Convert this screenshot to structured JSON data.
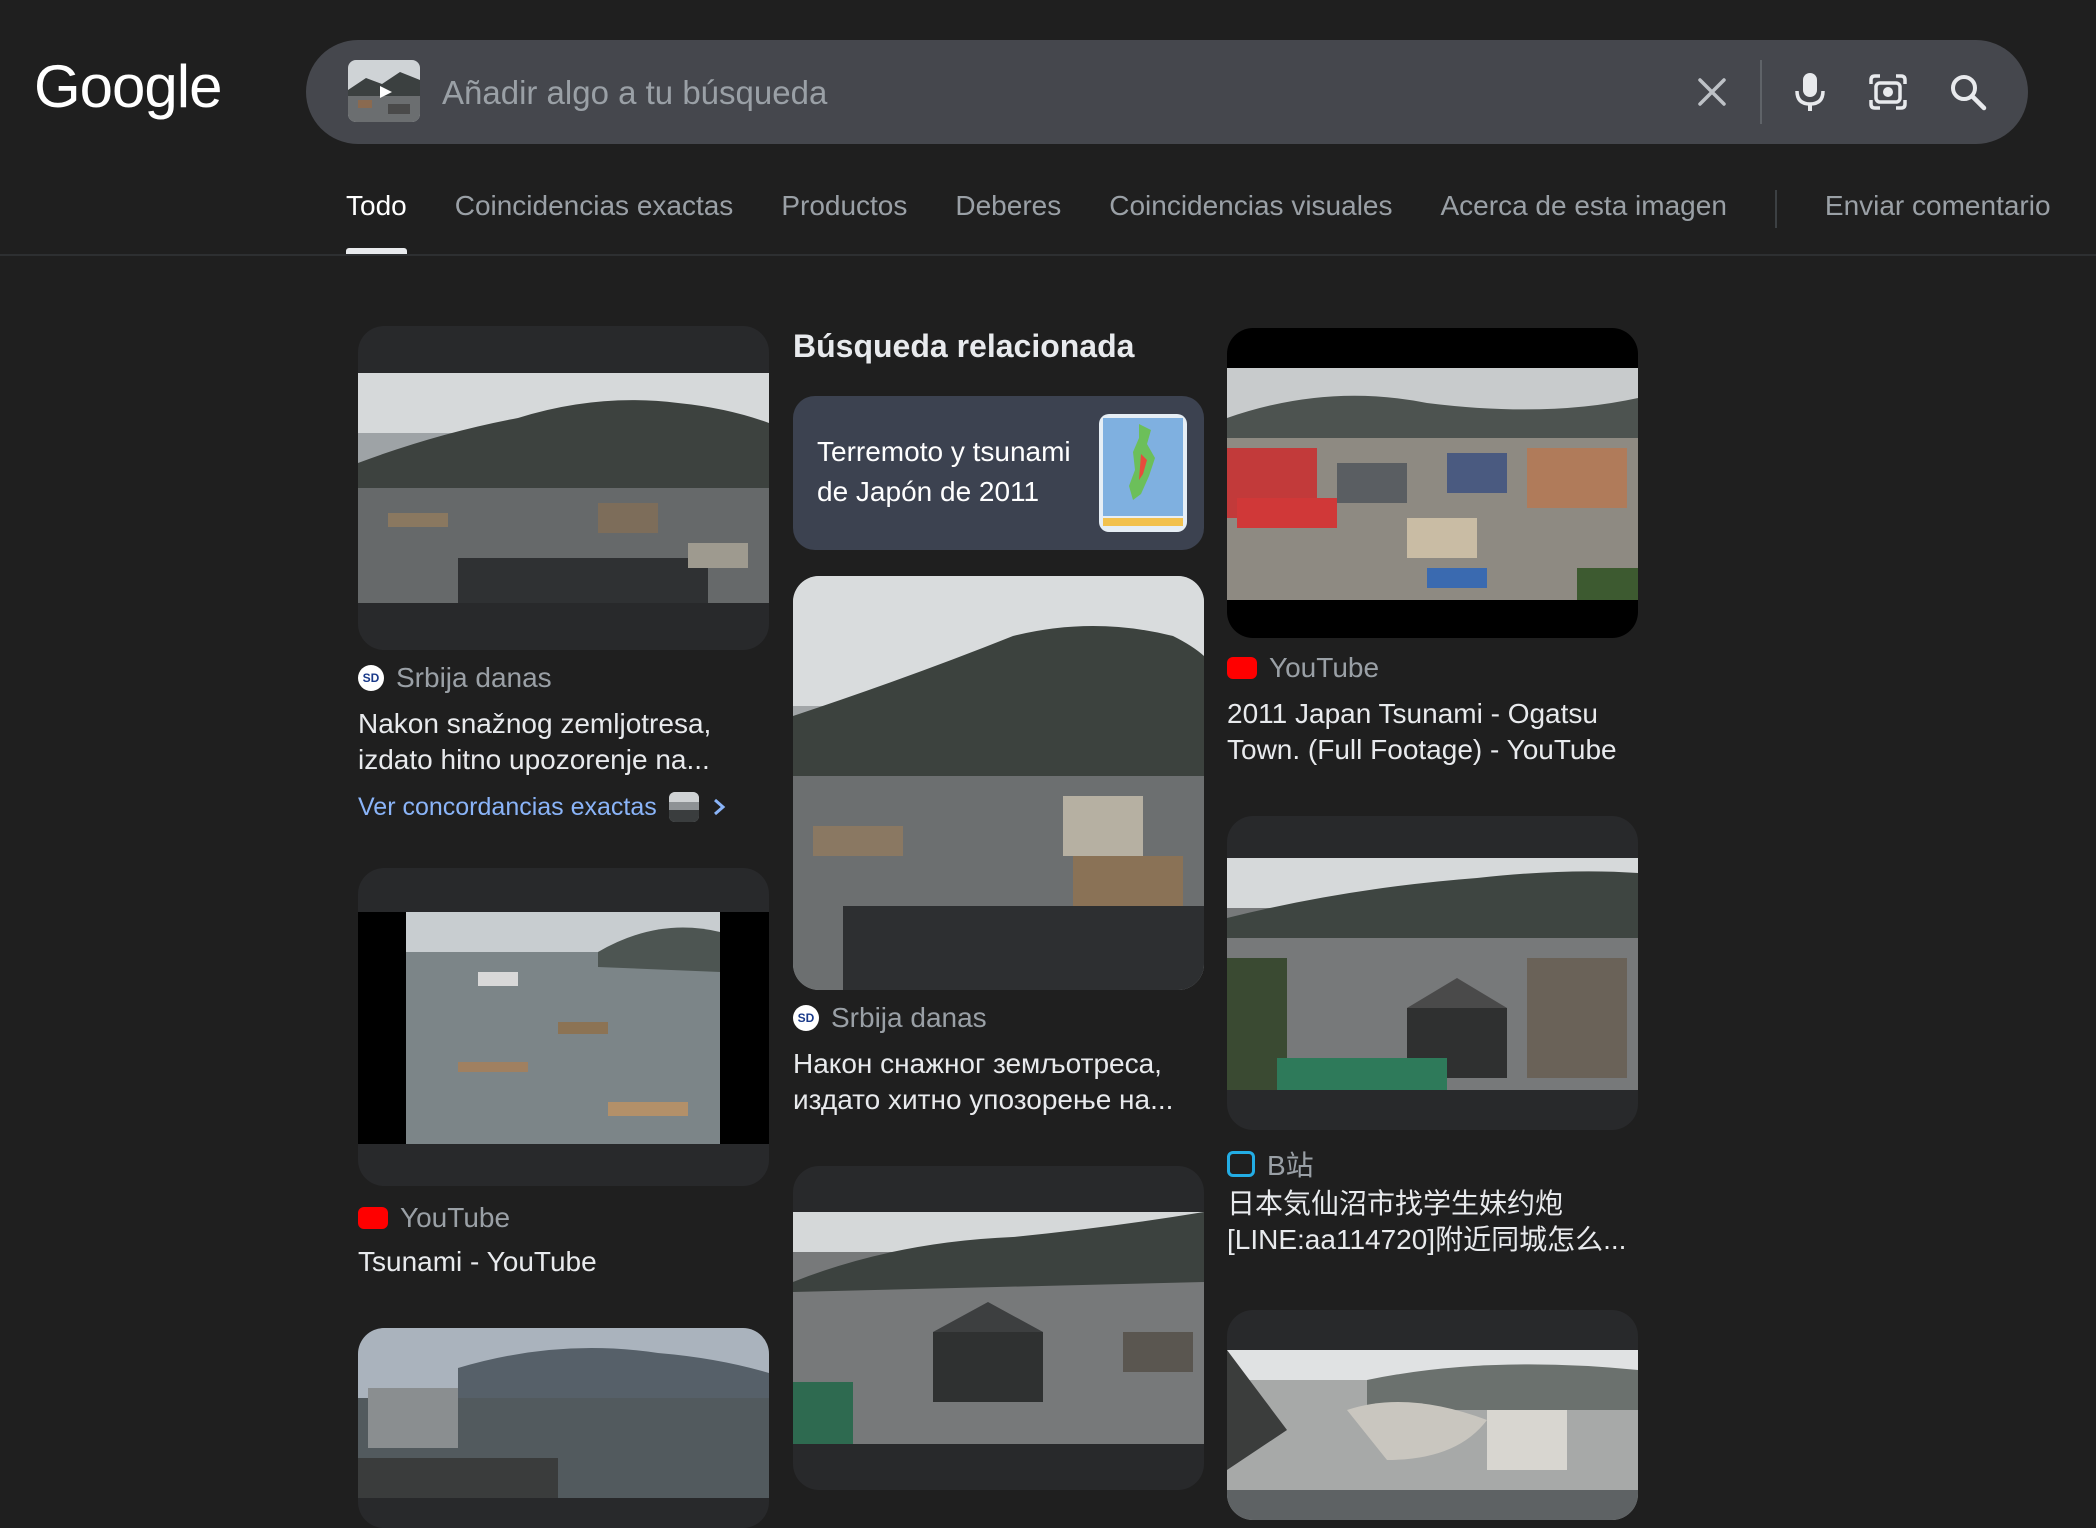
{
  "header": {
    "logo": "Google",
    "search": {
      "placeholder": "Añadir algo a tu búsqueda",
      "value": ""
    }
  },
  "tabs": [
    {
      "label": "Todo",
      "active": true
    },
    {
      "label": "Coincidencias exactas"
    },
    {
      "label": "Productos"
    },
    {
      "label": "Deberes"
    },
    {
      "label": "Coincidencias visuales"
    },
    {
      "label": "Acerca de esta imagen"
    },
    {
      "label": "Enviar comentario"
    }
  ],
  "related": {
    "heading": "Búsqueda relacionada",
    "text": "Terremoto y tsunami de Japón de 2011"
  },
  "results": {
    "r1": {
      "source": "Srbija danas",
      "title": "Nakon snažnog zemljotresa, izdato hitno upozorenje na...",
      "link": "Ver concordancias exactas"
    },
    "r2": {
      "source": "YouTube",
      "title": "Tsunami - YouTube"
    },
    "r3": {
      "source": "Srbija danas",
      "title": "Након снажног земљотреса, издато хитно упозорење на..."
    },
    "r4": {
      "source": "YouTube",
      "title": "2011 Japan Tsunami - Ogatsu Town. (Full Footage) - YouTube"
    },
    "r5": {
      "source": "B站",
      "title": "日本気仙沼市找学生妹约炮[LINE:aa114720]附近同城怎么..."
    }
  },
  "favicons": {
    "sd": "SD"
  },
  "icons": [
    "clear-icon",
    "mic-icon",
    "lens-icon",
    "search-icon",
    "chevron-right-icon",
    "youtube-icon",
    "bilibili-icon",
    "srbija-danas-icon"
  ]
}
